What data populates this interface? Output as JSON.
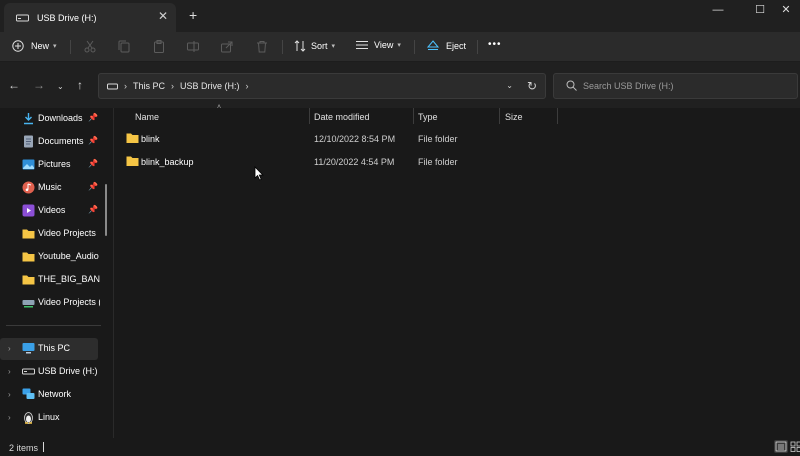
{
  "window": {
    "tab_title": "USB Drive (H:)",
    "tab_close": "✕",
    "new_tab": "+",
    "minimize": "—",
    "maximize": "☐",
    "close": "✕"
  },
  "toolbar": {
    "new_label": "New",
    "sort_label": "Sort",
    "view_label": "View",
    "eject_label": "Eject",
    "more_label": "•••"
  },
  "address": {
    "crumbs": [
      "This PC",
      "USB Drive (H:)"
    ],
    "search_placeholder": "Search USB Drive (H:)"
  },
  "nav": {
    "quick_access": [
      {
        "label": "Downloads",
        "pinned": true
      },
      {
        "label": "Documents",
        "pinned": true
      },
      {
        "label": "Pictures",
        "pinned": true
      },
      {
        "label": "Music",
        "pinned": true
      },
      {
        "label": "Videos",
        "pinned": true
      },
      {
        "label": "Video Projects",
        "pinned": false
      },
      {
        "label": "Youtube_Audio",
        "pinned": false
      },
      {
        "label": "THE_BIG_BANG_",
        "pinned": false
      },
      {
        "label": "Video Projects (\\",
        "pinned": false
      }
    ],
    "locations": [
      {
        "label": "This PC",
        "selected": true
      },
      {
        "label": "USB Drive (H:)",
        "selected": false
      },
      {
        "label": "Network",
        "selected": false
      },
      {
        "label": "Linux",
        "selected": false
      }
    ]
  },
  "columns": {
    "name": "Name",
    "date": "Date modified",
    "type": "Type",
    "size": "Size"
  },
  "files": [
    {
      "name": "blink",
      "date": "12/10/2022 8:54 PM",
      "type": "File folder",
      "size": ""
    },
    {
      "name": "blink_backup",
      "date": "11/20/2022 4:54 PM",
      "type": "File folder",
      "size": ""
    }
  ],
  "status": {
    "item_count": "2 items"
  },
  "colors": {
    "folder": "#f5c545",
    "accent": "#4cc2ff",
    "background": "#191919"
  }
}
